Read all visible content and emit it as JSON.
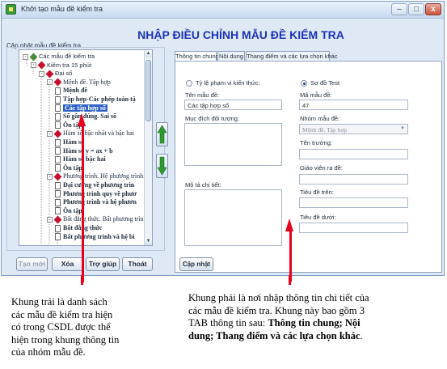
{
  "window": {
    "title": "Khởi tạo mẫu đề kiểm tra",
    "minimize": "–",
    "maximize": "□",
    "close": "x",
    "heading": "NHẬP ĐIỀU CHỈNH MẪU ĐỀ KIỂM TRA"
  },
  "left_panel": {
    "group_label": "Cập nhật mẫu đề kiểm tra",
    "tree": [
      {
        "label": "Các mẫu đề kiểm tra",
        "type": "root"
      },
      {
        "label": "Kiểm tra 15 phút",
        "type": "folder"
      },
      {
        "label": "Đại số",
        "type": "folder"
      },
      {
        "label": "Mệnh đề. Tập hợp",
        "type": "folder"
      },
      {
        "label": "Mệnh đề",
        "type": "leaf"
      },
      {
        "label": "Tập hợp-Các phép toán tậ",
        "type": "leaf"
      },
      {
        "label": "Các tập hợp số",
        "type": "leaf",
        "selected": true
      },
      {
        "label": "Số gần đúng. Sai số",
        "type": "leaf"
      },
      {
        "label": "Ôn tập",
        "type": "leaf"
      },
      {
        "label": "Hàm số bậc nhất và bậc hai",
        "type": "folder"
      },
      {
        "label": "Hàm số",
        "type": "leaf"
      },
      {
        "label": "Hàm số y = ax + b",
        "type": "leaf"
      },
      {
        "label": "Hàm số bậc hai",
        "type": "leaf"
      },
      {
        "label": "Ôn tập",
        "type": "leaf"
      },
      {
        "label": "Phương trình. Hệ phương trình.",
        "type": "folder"
      },
      {
        "label": "Đại cương về phương trìn",
        "type": "leaf"
      },
      {
        "label": "Phương trình quy về phươ",
        "type": "leaf"
      },
      {
        "label": "Phương trình và hệ phươn",
        "type": "leaf"
      },
      {
        "label": "Ôn tập",
        "type": "leaf"
      },
      {
        "label": "Bất đẳng thức. Bất phương trình",
        "type": "folder"
      },
      {
        "label": "Bất đẳng thức",
        "type": "leaf"
      },
      {
        "label": "Bất phương trình và hệ bì",
        "type": "leaf"
      }
    ],
    "buttons": {
      "new": "Tạo mới",
      "delete": "Xóa",
      "help": "Trợ giúp",
      "exit": "Thoát"
    }
  },
  "right_panel": {
    "tabs": [
      "Thông tin chung",
      "Nội dung",
      "Thang điểm và các lựa chọn khác"
    ],
    "radio_scope": "Tỷ lệ phạm vi kiến thức:",
    "radio_test": "Sơ đồ Test",
    "name_label": "Tên mẫu đề:",
    "name_value": "Các tập hợp số",
    "code_label": "Mã mẫu đề:",
    "code_value": "47",
    "purpose_label": "Mục đích đối tượng:",
    "group_label": "Nhóm mẫu đề:",
    "group_value": "Mệnh đề. Tập hợp",
    "school_label": "Tên trường:",
    "teacher_label": "Giáo viên ra đề:",
    "description_label": "Mô tả chi tiết:",
    "header_label": "Tiêu đề trên:",
    "footer_label": "Tiêu đề dưới:",
    "update_button": "Cập nhật"
  },
  "annotations": {
    "left_note": [
      "Khung trái là danh sách",
      "các mẫu đề kiểm tra hiện",
      "có trong CSDL được thể",
      "hiện trong khung thông tin",
      "của nhóm mẫu đề."
    ],
    "right_note_lines": [
      "Khung phải là nơi nhập thông tin chi tiết của",
      "các mẫu đề kiểm tra. Khung này bao gồm 3",
      "TAB thông tin sau: "
    ],
    "right_note_bold_1": "Thông tin chung; Nội",
    "right_note_bold_2": "dung; Thang điểm và các lựa chọn khác",
    "right_note_end": "."
  },
  "colors": {
    "heading": "#1b33b8",
    "selection": "#2f62c7",
    "tree_marker": "#c8102e",
    "arrow_green": "#2e9b2e",
    "annotation_line": "#e8001c"
  }
}
